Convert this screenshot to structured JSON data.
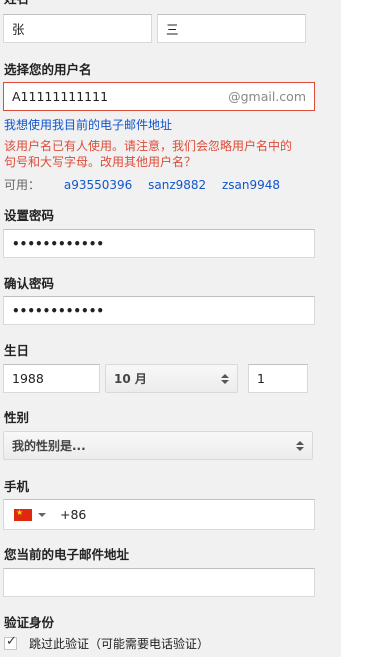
{
  "name": {
    "label": "姓名",
    "first_value": "张",
    "last_value": "三"
  },
  "username": {
    "label": "选择您的用户名",
    "value": "A11111111111",
    "suffix": "@gmail.com",
    "use_current_email_link": "我想使用我目前的电子邮件地址",
    "error_line1": "该用户名已有人使用。请注意，我们会忽略用户名中的",
    "error_line2": "句号和大写字母。改用其他用户名？",
    "available_label": "可用：",
    "suggestions": [
      "a93550396",
      "sanz9882",
      "zsan9948"
    ]
  },
  "password": {
    "label": "设置密码",
    "value": "••••••••••••"
  },
  "confirm_password": {
    "label": "确认密码",
    "value": "••••••••••••"
  },
  "birthday": {
    "label": "生日",
    "year": "1988",
    "month": "10 月",
    "day": "1"
  },
  "gender": {
    "label": "性别",
    "placeholder": "我的性别是..."
  },
  "phone": {
    "label": "手机",
    "country_code": "+86"
  },
  "current_email": {
    "label": "您当前的电子邮件地址",
    "value": ""
  },
  "verification": {
    "label": "验证身份",
    "skip_label": "跳过此验证（可能需要电话验证）",
    "skip_checked": true
  }
}
